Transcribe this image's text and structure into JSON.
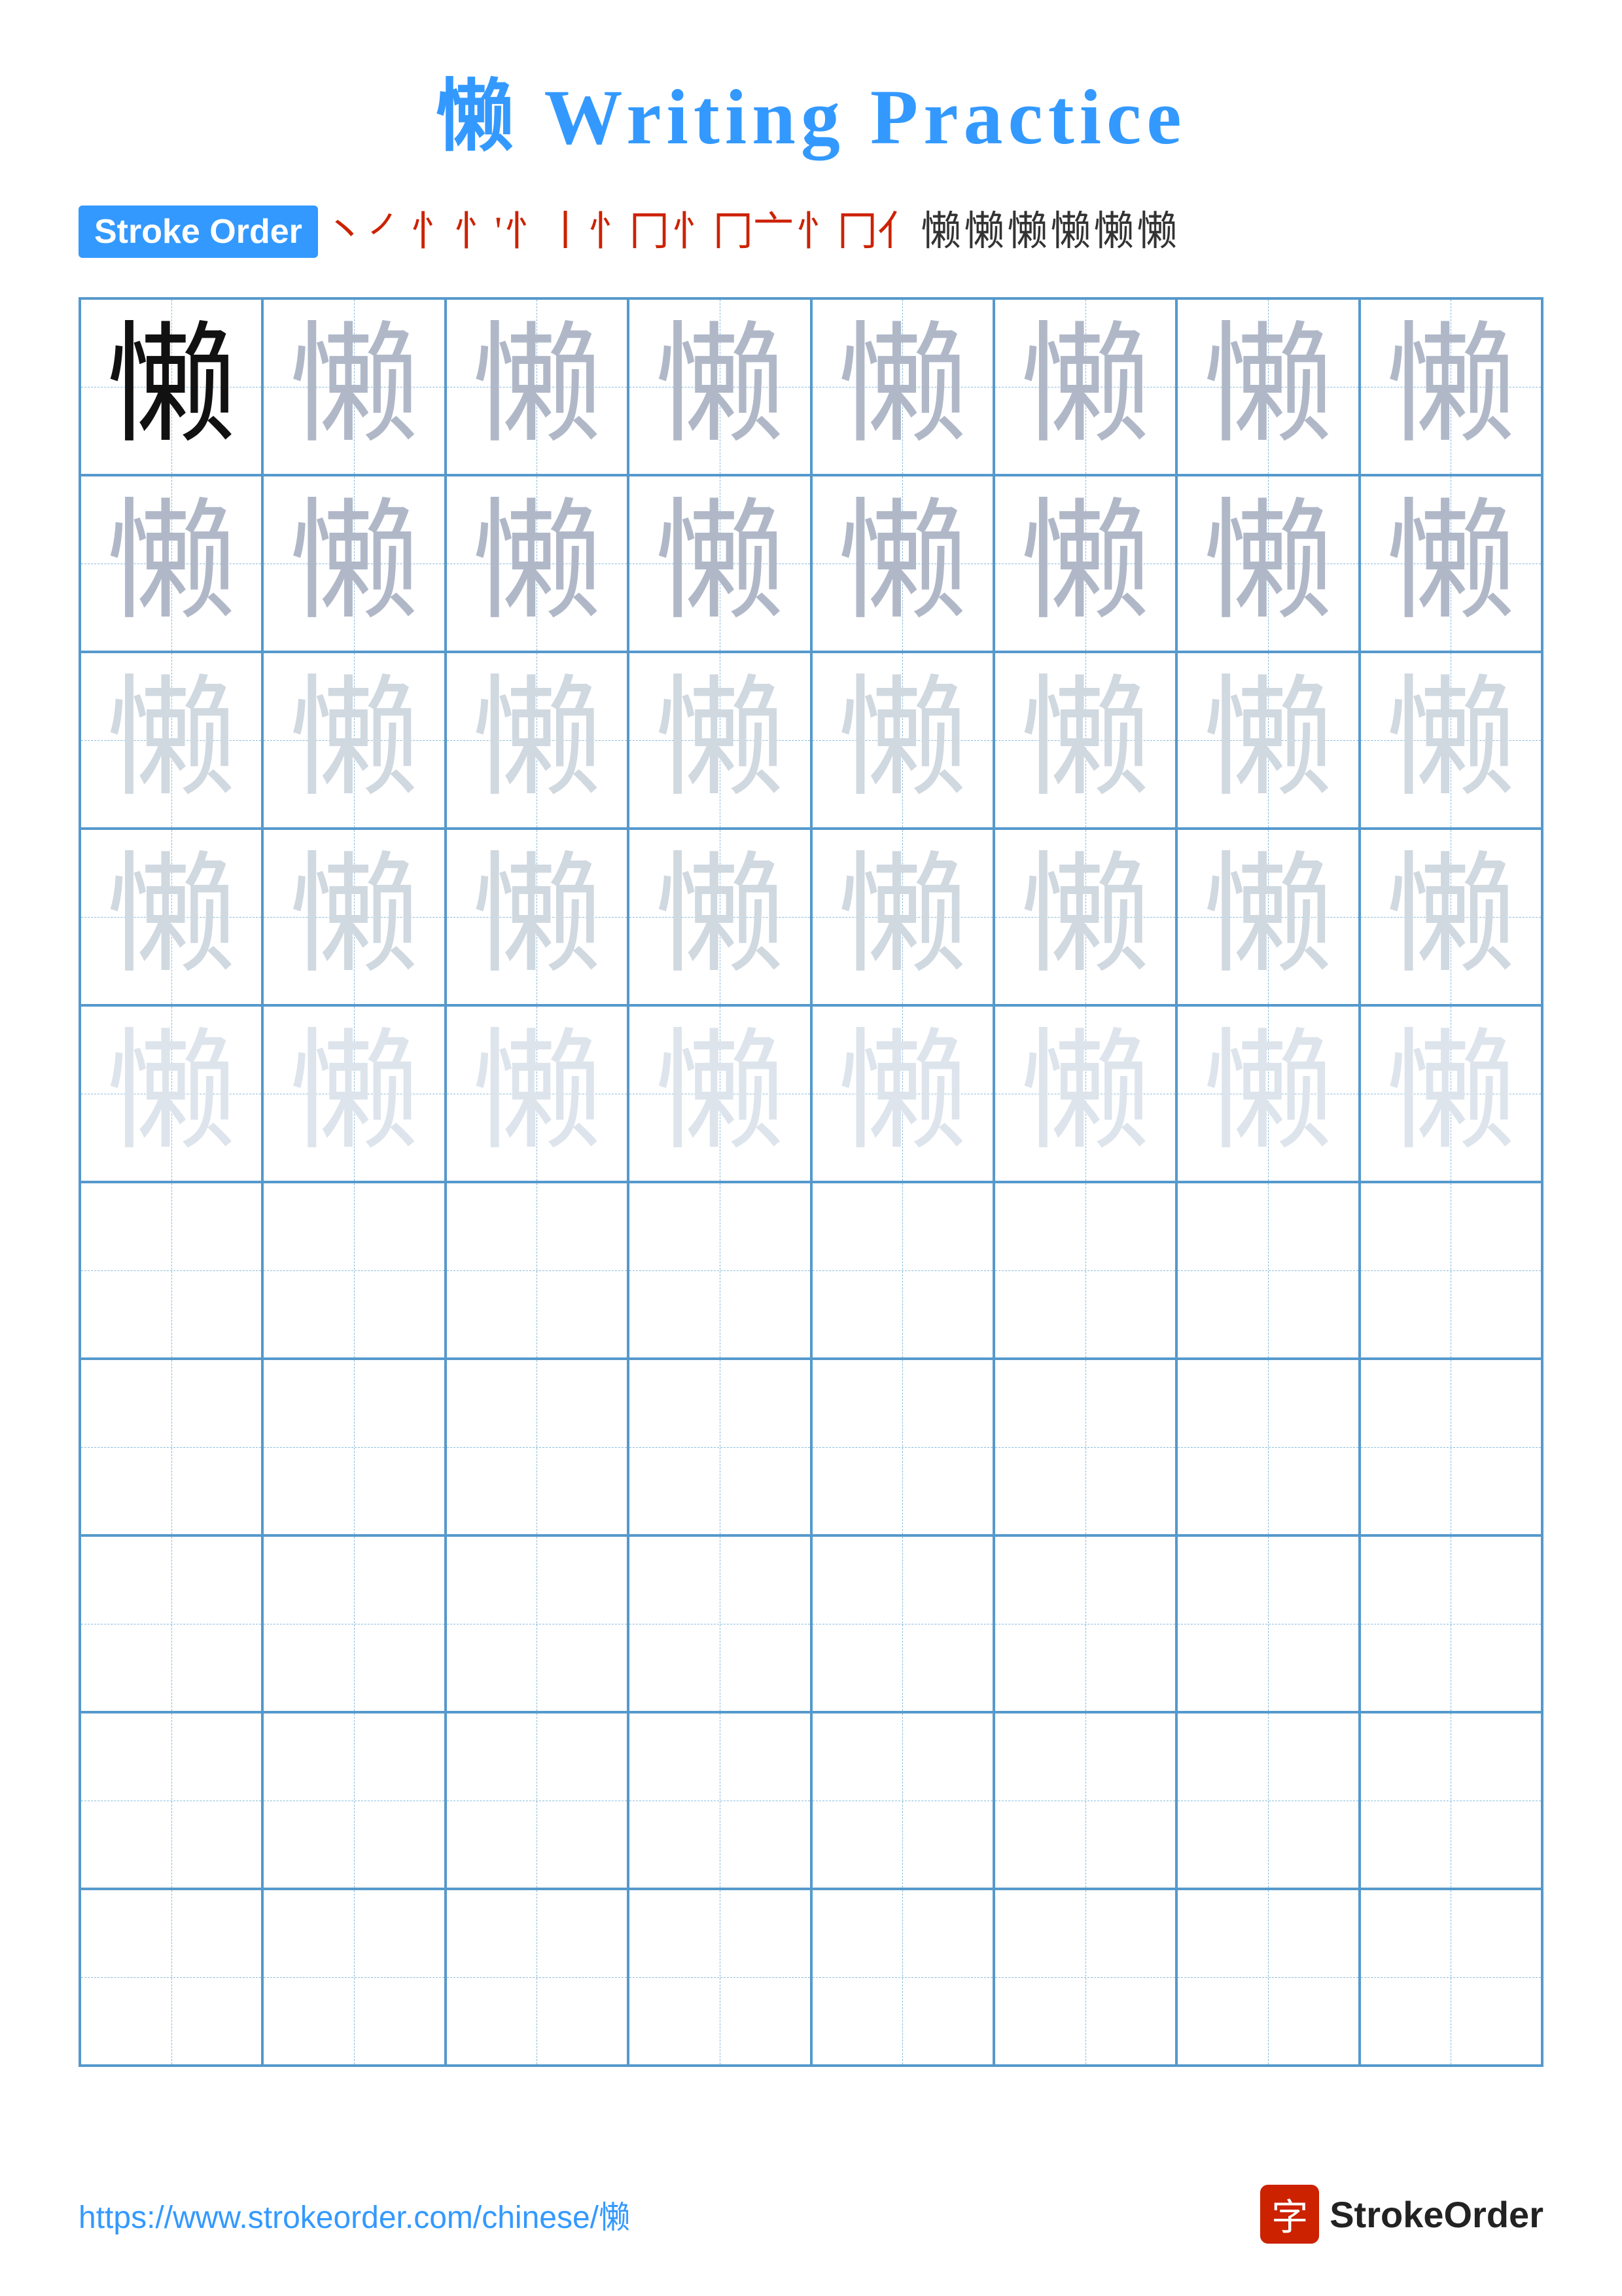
{
  "title": {
    "char": "懒",
    "text": " Writing Practice"
  },
  "stroke_order": {
    "label": "Stroke Order",
    "strokes": [
      "丶",
      "㇒",
      "丨",
      "㇀",
      "忄",
      "忄卜",
      "忄扑",
      "忄扑冂",
      "忄扑冂亠",
      "忄扑冂亠亻",
      "懒",
      "懒懒",
      "懒"
    ]
  },
  "grid": {
    "rows": 10,
    "cols": 8,
    "char": "懒",
    "practice_rows": [
      [
        {
          "shade": "dark"
        },
        {
          "shade": "medium-gray"
        },
        {
          "shade": "medium-gray"
        },
        {
          "shade": "medium-gray"
        },
        {
          "shade": "medium-gray"
        },
        {
          "shade": "medium-gray"
        },
        {
          "shade": "medium-gray"
        },
        {
          "shade": "medium-gray"
        }
      ],
      [
        {
          "shade": "medium-gray"
        },
        {
          "shade": "medium-gray"
        },
        {
          "shade": "medium-gray"
        },
        {
          "shade": "medium-gray"
        },
        {
          "shade": "medium-gray"
        },
        {
          "shade": "medium-gray"
        },
        {
          "shade": "medium-gray"
        },
        {
          "shade": "medium-gray"
        }
      ],
      [
        {
          "shade": "light-gray"
        },
        {
          "shade": "light-gray"
        },
        {
          "shade": "light-gray"
        },
        {
          "shade": "light-gray"
        },
        {
          "shade": "light-gray"
        },
        {
          "shade": "light-gray"
        },
        {
          "shade": "light-gray"
        },
        {
          "shade": "light-gray"
        }
      ],
      [
        {
          "shade": "light-gray"
        },
        {
          "shade": "light-gray"
        },
        {
          "shade": "light-gray"
        },
        {
          "shade": "light-gray"
        },
        {
          "shade": "light-gray"
        },
        {
          "shade": "light-gray"
        },
        {
          "shade": "light-gray"
        },
        {
          "shade": "light-gray"
        }
      ],
      [
        {
          "shade": "very-light"
        },
        {
          "shade": "very-light"
        },
        {
          "shade": "very-light"
        },
        {
          "shade": "very-light"
        },
        {
          "shade": "very-light"
        },
        {
          "shade": "very-light"
        },
        {
          "shade": "very-light"
        },
        {
          "shade": "very-light"
        }
      ],
      [
        {
          "shade": "empty"
        },
        {
          "shade": "empty"
        },
        {
          "shade": "empty"
        },
        {
          "shade": "empty"
        },
        {
          "shade": "empty"
        },
        {
          "shade": "empty"
        },
        {
          "shade": "empty"
        },
        {
          "shade": "empty"
        }
      ],
      [
        {
          "shade": "empty"
        },
        {
          "shade": "empty"
        },
        {
          "shade": "empty"
        },
        {
          "shade": "empty"
        },
        {
          "shade": "empty"
        },
        {
          "shade": "empty"
        },
        {
          "shade": "empty"
        },
        {
          "shade": "empty"
        }
      ],
      [
        {
          "shade": "empty"
        },
        {
          "shade": "empty"
        },
        {
          "shade": "empty"
        },
        {
          "shade": "empty"
        },
        {
          "shade": "empty"
        },
        {
          "shade": "empty"
        },
        {
          "shade": "empty"
        },
        {
          "shade": "empty"
        }
      ],
      [
        {
          "shade": "empty"
        },
        {
          "shade": "empty"
        },
        {
          "shade": "empty"
        },
        {
          "shade": "empty"
        },
        {
          "shade": "empty"
        },
        {
          "shade": "empty"
        },
        {
          "shade": "empty"
        },
        {
          "shade": "empty"
        }
      ],
      [
        {
          "shade": "empty"
        },
        {
          "shade": "empty"
        },
        {
          "shade": "empty"
        },
        {
          "shade": "empty"
        },
        {
          "shade": "empty"
        },
        {
          "shade": "empty"
        },
        {
          "shade": "empty"
        },
        {
          "shade": "empty"
        }
      ]
    ]
  },
  "footer": {
    "url": "https://www.strokeorder.com/chinese/懒",
    "logo_char": "字",
    "logo_text": "StrokeOrder"
  }
}
